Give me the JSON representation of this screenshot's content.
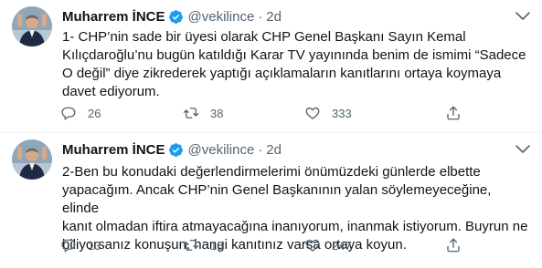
{
  "colors": {
    "text": "#0f1419",
    "secondary": "#536471",
    "verified": "#1d9bf0",
    "border": "#eff3f4"
  },
  "tweets": [
    {
      "name": "Muharrem İNCE",
      "handle": "@vekilince",
      "separator": "·",
      "time": "2d",
      "text": "1- CHP’nin sade bir üyesi olarak CHP Genel Başkanı Sayın Kemal\nKılıçdaroğlu’nu bugün katıldığı Karar TV yayınında benim de ismimi “Sadece\nO değil” diye zikrederek yaptığı açıklamaların kanıtlarını ortaya koymaya\ndavet ediyorum.",
      "replies": "26",
      "retweets": "38",
      "likes": "333",
      "icons": [
        "verified-badge-icon",
        "more-icon",
        "reply-icon",
        "retweet-icon",
        "like-icon",
        "share-icon"
      ]
    },
    {
      "name": "Muharrem İNCE",
      "handle": "@vekilince",
      "separator": "·",
      "time": "2d",
      "text": "2-Ben bu konudaki değerlendirmelerimi önümüzdeki günlerde elbette\nyapacağım. Ancak CHP’nin Genel Başkanının yalan söylemeyeceğine, elinde\nkanıt olmadan iftira atmayacağına inanıyorum, inanmak istiyorum. Buyrun ne\nbiliyorsanız konuşun, hangi kanıtınız varsa ortaya koyun.",
      "replies": "13",
      "retweets": "18",
      "likes": "247",
      "icons": [
        "verified-badge-icon",
        "more-icon",
        "reply-icon",
        "retweet-icon",
        "like-icon",
        "share-icon"
      ]
    }
  ]
}
